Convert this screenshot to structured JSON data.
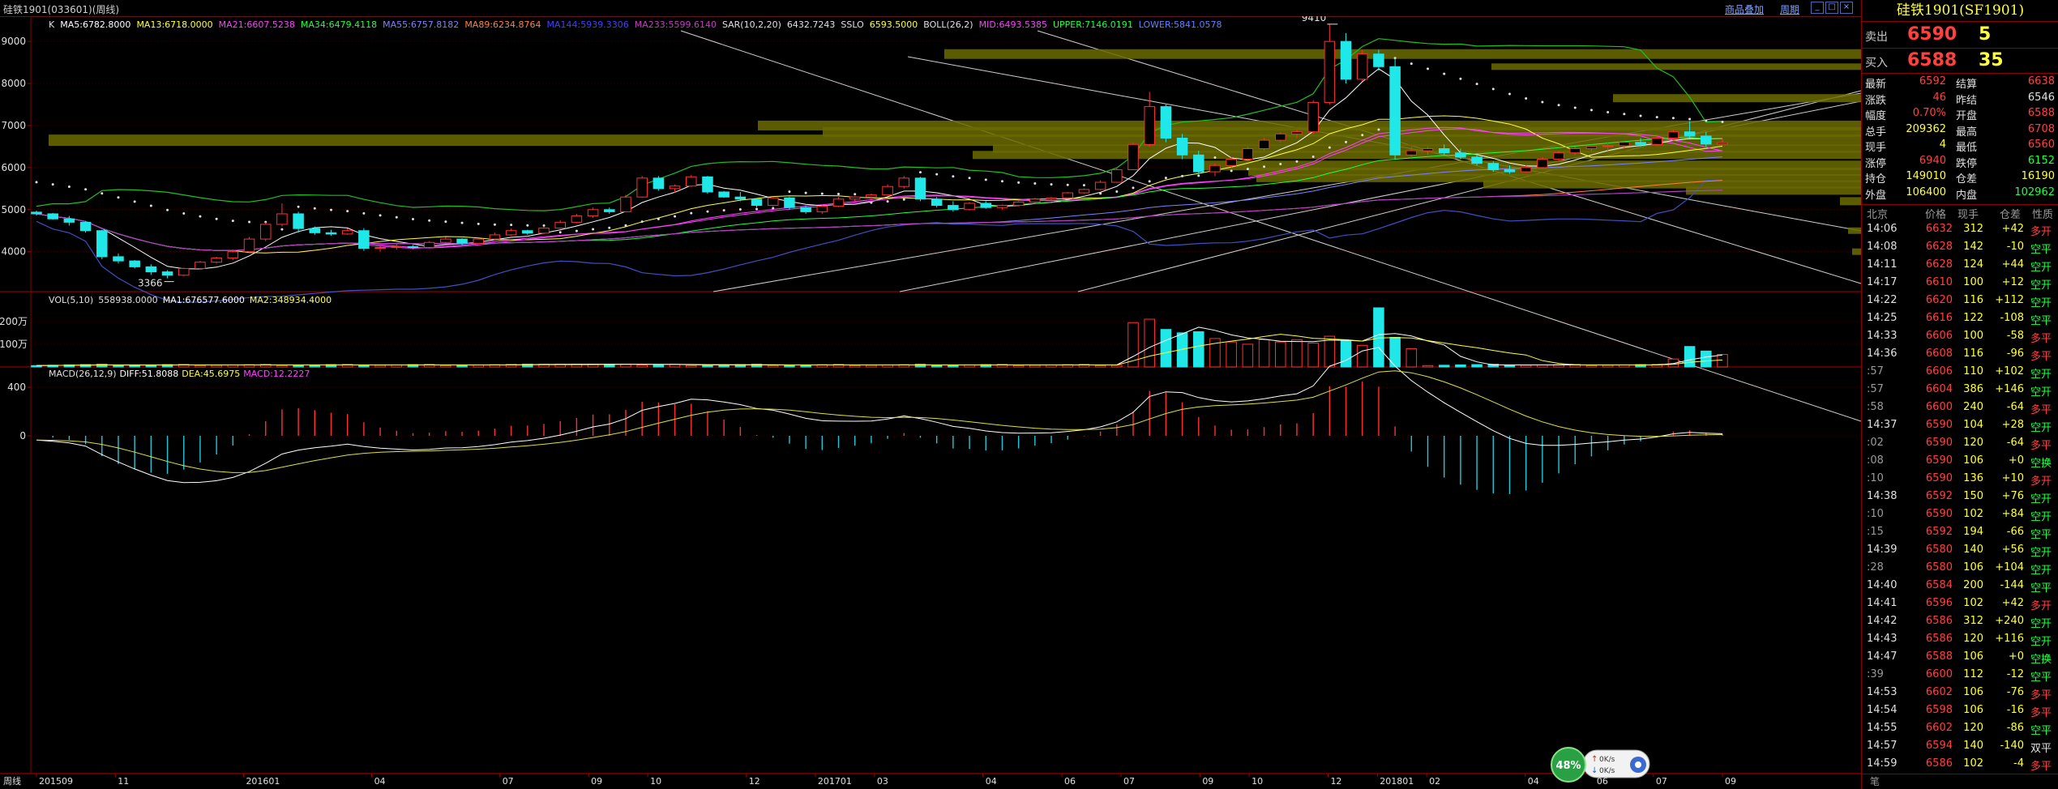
{
  "window": {
    "title": "硅铁1901(033601)(周线)",
    "menu": [
      "商品叠加",
      "周期"
    ]
  },
  "main_panel": {
    "indicator_text": "K  MA5:6782.8000  MA13:6718.0000  MA21:6607.5238  MA34:6479.4118  MA55:6757.8182  MA89:6234.8764  MA144:5939.3306  MA233:5599.6140  SAR(10,2,20)  6432.7243  SSLO  6593.5000  BOLL(26,2)  MID:6493.5385  UPPER:7146.0191  LOWER:5841.0578",
    "indicators": [
      {
        "text": "K",
        "color": "#e0e0e0"
      },
      {
        "text": "MA5:6782.8000",
        "color": "#ffffff"
      },
      {
        "text": "MA13:6718.0000",
        "color": "#ffff40"
      },
      {
        "text": "MA21:6607.5238",
        "color": "#ff40ff"
      },
      {
        "text": "MA34:6479.4118",
        "color": "#20ff40"
      },
      {
        "text": "MA55:6757.8182",
        "color": "#8080ff"
      },
      {
        "text": "MA89:6234.8764",
        "color": "#ff8040"
      },
      {
        "text": "MA144:5939.3306",
        "color": "#4040ff"
      },
      {
        "text": "MA233:5599.6140",
        "color": "#c040c0"
      },
      {
        "text": "SAR(10,2,20)",
        "color": "#e0e0e0"
      },
      {
        "text": "6432.7243",
        "color": "#e0e0e0"
      },
      {
        "text": "SSLO",
        "color": "#e0e0e0"
      },
      {
        "text": "6593.5000",
        "color": "#ffff40"
      },
      {
        "text": "BOLL(26,2)",
        "color": "#e0e0e0"
      },
      {
        "text": "MID:6493.5385",
        "color": "#ff40ff"
      },
      {
        "text": "UPPER:7146.0191",
        "color": "#20ff40"
      },
      {
        "text": "LOWER:5841.0578",
        "color": "#6080ff"
      }
    ],
    "y_ticks": [
      "9000",
      "8000",
      "7000",
      "6000",
      "5000",
      "4000"
    ],
    "high_label": "9410",
    "low_label": "3366"
  },
  "volume_panel": {
    "indicators": [
      {
        "text": "VOL(5,10)",
        "color": "#e0e0e0"
      },
      {
        "text": "558938.0000",
        "color": "#e0e0e0"
      },
      {
        "text": "MA1:676577.6000",
        "color": "#ffffff"
      },
      {
        "text": "MA2:348934.4000",
        "color": "#ffff40"
      }
    ],
    "y_ticks": [
      "200万",
      "100万"
    ]
  },
  "macd_panel": {
    "indicators": [
      {
        "text": "MACD(26,12,9)",
        "color": "#e0e0e0"
      },
      {
        "text": "DIFF:51.8088",
        "color": "#ffffff"
      },
      {
        "text": "DEA:45.6975",
        "color": "#ffff40"
      },
      {
        "text": "MACD:12.2227",
        "color": "#ff40ff"
      }
    ],
    "y_ticks": [
      "400",
      "0"
    ]
  },
  "x_axis": {
    "period_label": "周线",
    "ticks": [
      "201509",
      "11",
      "201601",
      "04",
      "07",
      "09",
      "10",
      "12",
      "201701",
      "03",
      "04",
      "06",
      "07",
      "09",
      "10",
      "12",
      "201801",
      "02",
      "04",
      "06",
      "07",
      "09"
    ]
  },
  "widget": {
    "percent": "48%",
    "up": "0K/s",
    "down": "0K/s"
  },
  "quote": {
    "title": "硅铁1901(SF1901)",
    "sell_label": "卖出",
    "sell_price": "6590",
    "sell_vol": "5",
    "buy_label": "买入",
    "buy_price": "6588",
    "buy_vol": "35",
    "rows": [
      [
        "最新",
        "6592",
        "结算",
        "6638"
      ],
      [
        "涨跌",
        "46",
        "昨结",
        "6546"
      ],
      [
        "幅度",
        "0.70%",
        "开盘",
        "6588"
      ],
      [
        "总手",
        "209362",
        "最高",
        "6708"
      ],
      [
        "现手",
        "4",
        "最低",
        "6560"
      ],
      [
        "涨停",
        "6940",
        "跌停",
        "6152"
      ],
      [
        "持仓",
        "149010",
        "仓差",
        "16190"
      ],
      [
        "外盘",
        "106400",
        "内盘",
        "102962"
      ]
    ],
    "trade_header": [
      "北京",
      "价格",
      "现手",
      "仓差",
      "性质"
    ],
    "trades": [
      [
        "14:06",
        "6632",
        "312",
        "+42",
        "多开"
      ],
      [
        "14:08",
        "6628",
        "142",
        "-10",
        "空平"
      ],
      [
        "14:11",
        "6628",
        "124",
        "+44",
        "空开"
      ],
      [
        "14:17",
        "6610",
        "100",
        "+12",
        "空开"
      ],
      [
        "14:22",
        "6620",
        "116",
        "+112",
        "空开"
      ],
      [
        "14:25",
        "6616",
        "122",
        "-108",
        "空平"
      ],
      [
        "14:33",
        "6606",
        "100",
        "-58",
        "多平"
      ],
      [
        "14:36",
        "6608",
        "116",
        "-96",
        "多平"
      ],
      [
        ":57",
        "6606",
        "110",
        "+102",
        "空开"
      ],
      [
        ":57",
        "6604",
        "386",
        "+146",
        "空开"
      ],
      [
        ":58",
        "6600",
        "240",
        "-64",
        "多平"
      ],
      [
        "14:37",
        "6590",
        "104",
        "+28",
        "空开"
      ],
      [
        ":02",
        "6590",
        "120",
        "-64",
        "多平"
      ],
      [
        ":08",
        "6590",
        "106",
        "+0",
        "空换"
      ],
      [
        ":10",
        "6590",
        "136",
        "+10",
        "多开"
      ],
      [
        "14:38",
        "6592",
        "150",
        "+76",
        "空开"
      ],
      [
        ":10",
        "6590",
        "102",
        "+84",
        "空开"
      ],
      [
        ":15",
        "6592",
        "194",
        "-66",
        "空平"
      ],
      [
        "14:39",
        "6580",
        "140",
        "+56",
        "空开"
      ],
      [
        ":28",
        "6580",
        "106",
        "+104",
        "空开"
      ],
      [
        "14:40",
        "6584",
        "200",
        "-144",
        "空平"
      ],
      [
        "14:41",
        "6596",
        "102",
        "+42",
        "多开"
      ],
      [
        "14:42",
        "6586",
        "312",
        "+240",
        "空开"
      ],
      [
        "14:43",
        "6586",
        "120",
        "+116",
        "空开"
      ],
      [
        "14:47",
        "6588",
        "106",
        "+0",
        "空换"
      ],
      [
        ":39",
        "6600",
        "112",
        "-12",
        "空平"
      ],
      [
        "14:53",
        "6602",
        "106",
        "-76",
        "多平"
      ],
      [
        "14:54",
        "6598",
        "106",
        "-16",
        "多平"
      ],
      [
        "14:55",
        "6602",
        "120",
        "-86",
        "空平"
      ],
      [
        "14:57",
        "6594",
        "140",
        "-140",
        "双平"
      ],
      [
        "14:59",
        "6586",
        "102",
        "-4",
        "多平"
      ]
    ],
    "footer": "笔"
  },
  "chart_data": {
    "type": "candlestick",
    "period": "weekly",
    "price_range": [
      3050,
      9600
    ],
    "candles": [
      [
        4940,
        4980,
        4860,
        4900
      ],
      [
        4900,
        4920,
        4760,
        4780
      ],
      [
        4780,
        4850,
        4620,
        4700
      ],
      [
        4700,
        4720,
        4450,
        4500
      ],
      [
        4500,
        4520,
        3820,
        3880
      ],
      [
        3880,
        3960,
        3720,
        3780
      ],
      [
        3780,
        3800,
        3600,
        3640
      ],
      [
        3640,
        3700,
        3450,
        3520
      ],
      [
        3520,
        3560,
        3366,
        3440
      ],
      [
        3440,
        3620,
        3420,
        3600
      ],
      [
        3600,
        3780,
        3580,
        3750
      ],
      [
        3750,
        3880,
        3720,
        3850
      ],
      [
        3850,
        4050,
        3800,
        4000
      ],
      [
        4000,
        4350,
        3980,
        4300
      ],
      [
        4300,
        4700,
        4250,
        4650
      ],
      [
        4650,
        5150,
        4600,
        4900
      ],
      [
        4900,
        4950,
        4450,
        4550
      ],
      [
        4550,
        4600,
        4400,
        4450
      ],
      [
        4450,
        4520,
        4380,
        4420
      ],
      [
        4420,
        4550,
        4400,
        4500
      ],
      [
        4500,
        4560,
        4020,
        4080
      ],
      [
        4080,
        4150,
        4000,
        4100
      ],
      [
        4100,
        4180,
        4050,
        4120
      ],
      [
        4120,
        4160,
        4060,
        4100
      ],
      [
        4100,
        4250,
        4080,
        4220
      ],
      [
        4220,
        4350,
        4180,
        4300
      ],
      [
        4300,
        4320,
        4150,
        4200
      ],
      [
        4200,
        4320,
        4180,
        4300
      ],
      [
        4300,
        4450,
        4280,
        4400
      ],
      [
        4400,
        4550,
        4380,
        4500
      ],
      [
        4500,
        4520,
        4400,
        4440
      ],
      [
        4440,
        4600,
        4420,
        4560
      ],
      [
        4560,
        4750,
        4540,
        4700
      ],
      [
        4700,
        4900,
        4680,
        4850
      ],
      [
        4850,
        5050,
        4800,
        5000
      ],
      [
        5000,
        5050,
        4900,
        4950
      ],
      [
        4950,
        5350,
        4940,
        5300
      ],
      [
        5300,
        5800,
        5280,
        5750
      ],
      [
        5750,
        5800,
        5450,
        5500
      ],
      [
        5500,
        5600,
        5400,
        5560
      ],
      [
        5560,
        5820,
        5540,
        5780
      ],
      [
        5780,
        5800,
        5380,
        5420
      ],
      [
        5420,
        5440,
        5280,
        5300
      ],
      [
        5300,
        5420,
        5200,
        5250
      ],
      [
        5250,
        5260,
        5050,
        5100
      ],
      [
        5100,
        5300,
        5080,
        5280
      ],
      [
        5280,
        5300,
        5000,
        5050
      ],
      [
        5050,
        5100,
        4900,
        4950
      ],
      [
        4950,
        5100,
        4900,
        5080
      ],
      [
        5080,
        5300,
        5060,
        5250
      ],
      [
        5250,
        5320,
        5200,
        5300
      ],
      [
        5300,
        5380,
        5250,
        5350
      ],
      [
        5350,
        5600,
        5330,
        5550
      ],
      [
        5550,
        5800,
        5500,
        5750
      ],
      [
        5750,
        5780,
        5200,
        5250
      ],
      [
        5250,
        5300,
        5050,
        5100
      ],
      [
        5100,
        5200,
        4950,
        5000
      ],
      [
        5000,
        5180,
        4980,
        5150
      ],
      [
        5150,
        5200,
        5020,
        5050
      ],
      [
        5050,
        5120,
        5000,
        5100
      ],
      [
        5100,
        5200,
        5080,
        5180
      ],
      [
        5180,
        5280,
        5150,
        5250
      ],
      [
        5250,
        5300,
        5200,
        5280
      ],
      [
        5280,
        5420,
        5260,
        5400
      ],
      [
        5400,
        5500,
        5380,
        5480
      ],
      [
        5480,
        5700,
        5460,
        5650
      ],
      [
        5650,
        6000,
        5640,
        5950
      ],
      [
        5950,
        6600,
        5940,
        6550
      ],
      [
        6550,
        7800,
        6500,
        7450
      ],
      [
        7450,
        7500,
        6600,
        6700
      ],
      [
        6700,
        6800,
        6200,
        6300
      ],
      [
        6300,
        6400,
        5850,
        5900
      ],
      [
        5900,
        6100,
        5800,
        6050
      ],
      [
        6050,
        6250,
        6000,
        6200
      ],
      [
        6200,
        6500,
        6150,
        6450
      ],
      [
        6450,
        6700,
        6400,
        6650
      ],
      [
        6650,
        6850,
        6600,
        6800
      ],
      [
        6800,
        6900,
        6700,
        6850
      ],
      [
        6850,
        7600,
        6800,
        7550
      ],
      [
        7550,
        9410,
        7500,
        9000
      ],
      [
        9000,
        9200,
        8000,
        8100
      ],
      [
        8100,
        8800,
        8050,
        8700
      ],
      [
        8700,
        8800,
        8300,
        8400
      ],
      [
        8400,
        8600,
        6200,
        6300
      ],
      [
        6300,
        6500,
        6200,
        6400
      ],
      [
        6400,
        6500,
        6300,
        6450
      ],
      [
        6450,
        6550,
        6300,
        6350
      ],
      [
        6350,
        6450,
        6200,
        6250
      ],
      [
        6250,
        6300,
        6050,
        6100
      ],
      [
        6100,
        6150,
        5900,
        5950
      ],
      [
        5950,
        6050,
        5850,
        5900
      ],
      [
        5900,
        6050,
        5880,
        6000
      ],
      [
        6000,
        6250,
        5980,
        6200
      ],
      [
        6200,
        6400,
        6150,
        6350
      ],
      [
        6350,
        6500,
        6300,
        6450
      ],
      [
        6450,
        6550,
        6380,
        6500
      ],
      [
        6500,
        6600,
        6400,
        6520
      ],
      [
        6520,
        6650,
        6450,
        6600
      ],
      [
        6600,
        6700,
        6500,
        6550
      ],
      [
        6550,
        6750,
        6520,
        6700
      ],
      [
        6700,
        6900,
        6650,
        6850
      ],
      [
        6850,
        7100,
        6700,
        6750
      ],
      [
        6750,
        6850,
        6500,
        6560
      ],
      [
        6560,
        6708,
        6560,
        6592
      ]
    ]
  }
}
